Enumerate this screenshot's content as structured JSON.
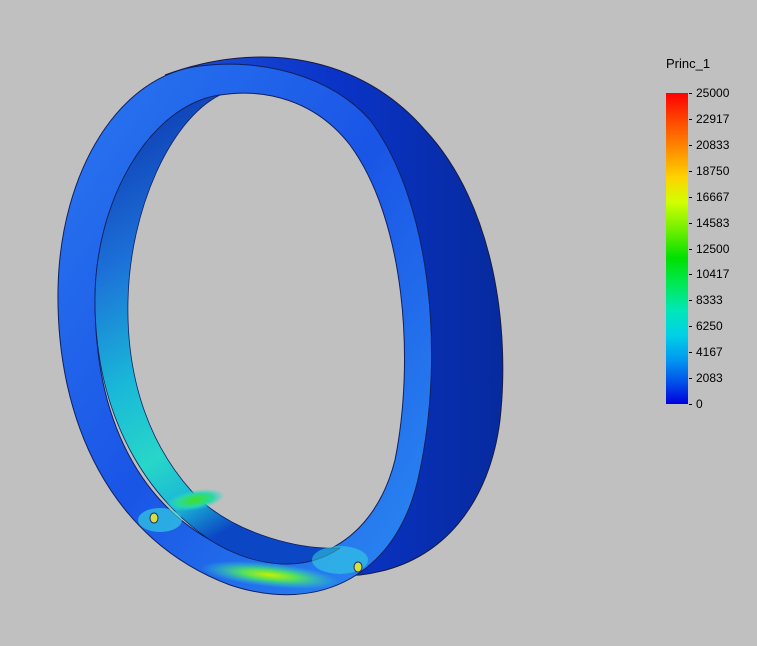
{
  "legend": {
    "title": "Princ_1",
    "values": [
      "25000",
      "22917",
      "20833",
      "18750",
      "16667",
      "14583",
      "12500",
      "10417",
      "8333",
      "6250",
      "4167",
      "2083",
      "0"
    ]
  },
  "colors": {
    "background": "#c0c0c0",
    "low": "#0000e0",
    "high": "#ff0000"
  }
}
